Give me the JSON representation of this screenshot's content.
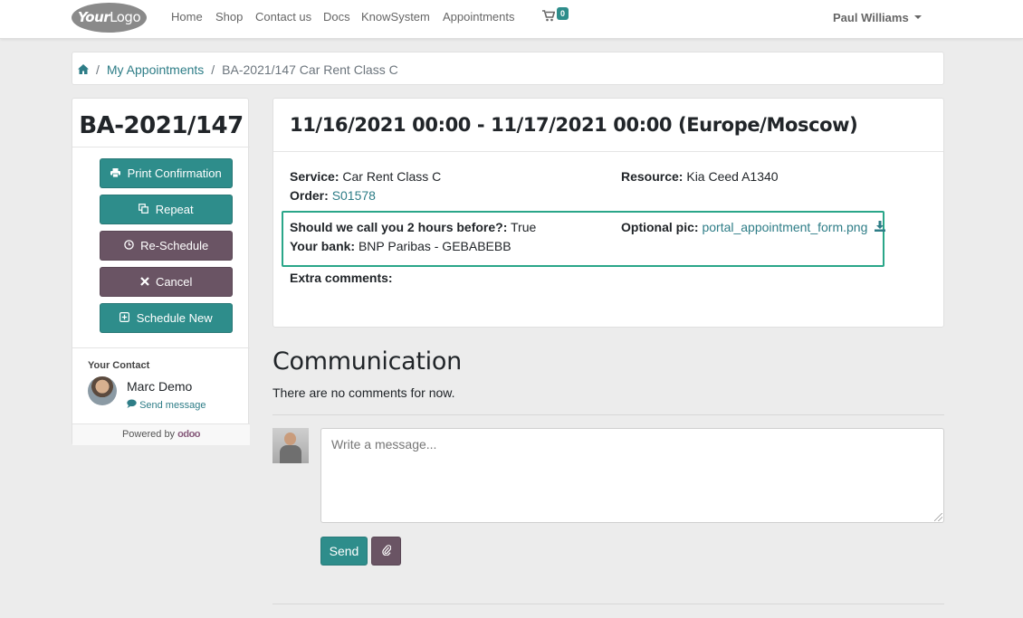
{
  "navbar": {
    "logo_bold": "Your",
    "logo_light": "Logo",
    "items": [
      "Home",
      "Shop",
      "Contact us",
      "Docs",
      "KnowSystem",
      "Appointments"
    ],
    "cart_count": "0",
    "user": "Paul Williams"
  },
  "breadcrumb": {
    "link": "My Appointments",
    "current": "BA-2021/147 Car Rent Class C"
  },
  "sidebar": {
    "title": "BA-2021/147",
    "buttons": {
      "print": "Print Confirmation",
      "repeat": "Repeat",
      "reschedule": "Re-Schedule",
      "cancel": "Cancel",
      "schedule_new": "Schedule New"
    },
    "contact_heading": "Your Contact",
    "contact_name": "Marc Demo",
    "send_message": "Send message",
    "powered_by": "Powered by",
    "powered_brand": "odoo"
  },
  "appointment": {
    "title": "11/16/2021 00:00 - 11/17/2021 00:00 (Europe/Moscow)",
    "service_label": "Service:",
    "service_value": "Car Rent Class C",
    "resource_label": "Resource:",
    "resource_value": "Kia Ceed A1340",
    "order_label": "Order:",
    "order_value": "S01578",
    "call_label": "Should we call you 2 hours before?:",
    "call_value": "True",
    "bank_label": "Your bank:",
    "bank_value": "BNP Paribas - GEBABEBB",
    "pic_label": "Optional pic:",
    "pic_value": "portal_appointment_form.png",
    "comments_label": "Extra comments:"
  },
  "communication": {
    "title": "Communication",
    "empty_text": "There are no comments for now.",
    "placeholder": "Write a message...",
    "send_label": "Send"
  },
  "colors": {
    "accent_teal": "#2e8d8b",
    "accent_purple": "#6a5464",
    "highlight_border": "#2aa689"
  }
}
